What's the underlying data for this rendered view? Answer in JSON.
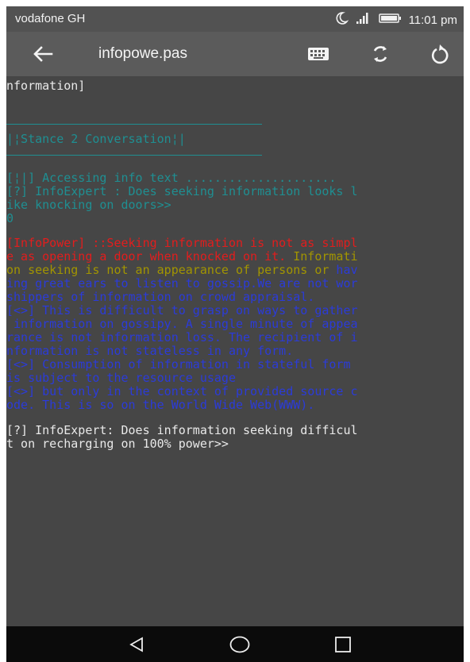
{
  "status_bar": {
    "carrier": "vodafone GH",
    "time": "11:01 pm"
  },
  "app_bar": {
    "title": "infopowe.pas"
  },
  "terminal": {
    "line_1": "nformation]",
    "section": "|¦Stance 2 Conversation¦|",
    "line_access": "[¦|] Accessing info text .....................",
    "q1_a": "[?] InfoExpert : Does seeking information looks l",
    "q1_b": "ike knocking on doors>>",
    "q1_c": "0",
    "ip_a": "[InfoPower] ::Seeking information is not as simpl",
    "ip_b_red": "e as opening a door when knocked on it. ",
    "ip_b_olive": "Informati",
    "ip_c_olive": "on seeking is not an appearance of persons or ",
    "ip_c_blue": "hav",
    "b1": "ing great ears to listen to gossip.We are not wor",
    "b2": "shippers of information on crowd appraisal.",
    "b3": "[<>] This is difficult to grasp on ways to gather",
    "b4": " information on gossipy. A single minute of appea",
    "b5": "rance is not information loss. The recipient of i",
    "b6": "nformation is not stateless in any form.",
    "b7": "[<>] Consumption of information in stateful form",
    "b8": "is subject to the resource usage",
    "b9": "[<>] but only in the context of provided source c",
    "b10": "ode. This is so on the World Wide Web(WWW).",
    "q2_a": "[?] InfoExpert: Does information seeking difficul",
    "q2_b": "t on recharging on 100% power>>"
  },
  "icons": [
    "moon-icon",
    "signal-icon",
    "battery-icon",
    "back-arrow-icon",
    "keyboard-icon",
    "sync-icon",
    "refresh-icon",
    "nav-back-icon",
    "nav-home-icon",
    "nav-recents-icon"
  ],
  "colors": {
    "terminal_bg": "#464646",
    "appbar": "#5b5b5b",
    "teal": "#1f8f92",
    "red": "#e21d1d",
    "olive": "#a29500",
    "blue": "#2b3bd9",
    "text": "#e9e9e9"
  }
}
